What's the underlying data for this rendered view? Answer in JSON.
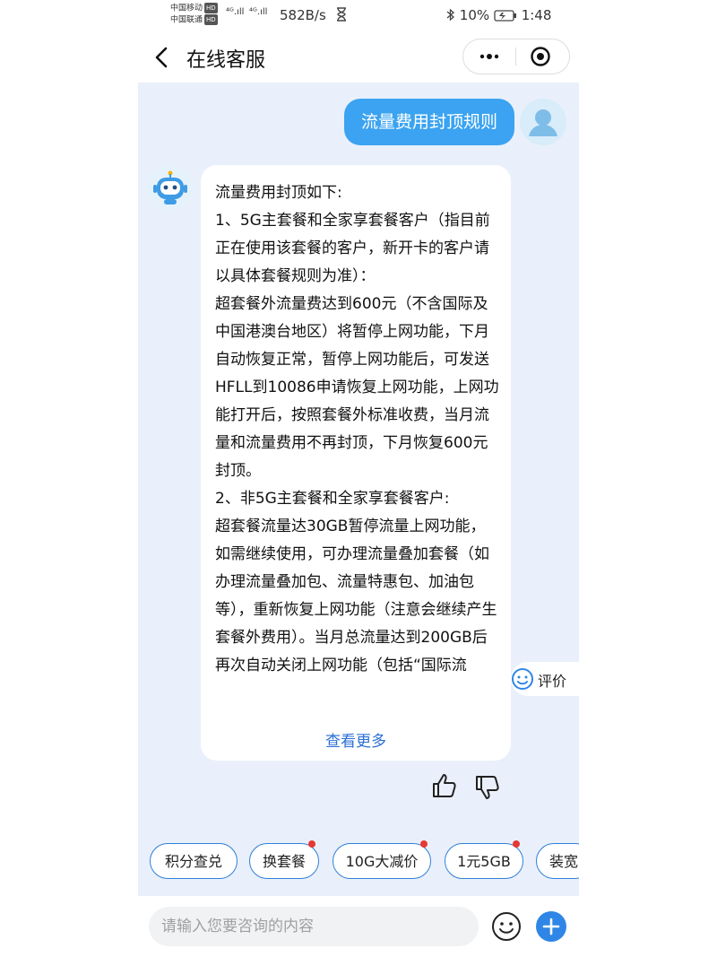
{
  "status_bar": {
    "carrier1": "中国移动",
    "carrier2": "中国联通",
    "hd": "HD",
    "signal1": "⁴ᴳ.ıll",
    "signal2": "⁴ᴳ.ıll",
    "speed": "582B/s",
    "battery": "10%",
    "time": "1:48"
  },
  "header": {
    "title": "在线客服"
  },
  "chat": {
    "user_message": "流量费用封顶规则",
    "bot_message": "流量费用封顶如下:\n1、5G主套餐和全家享套餐客户（指目前正在使用该套餐的客户，新开卡的客户请以具体套餐规则为准）：\n超套餐外流量费达到600元（不含国际及中国港澳台地区）将暂停上网功能，下月自动恢复正常，暂停上网功能后，可发送HFLL到10086申请恢复上网功能，上网功能打开后，按照套餐外标准收费，当月流量和流量费用不再封顶，下月恢复600元封顶。\n2、非5G主套餐和全家享套餐客户:\n超套餐流量达30GB暂停流量上网功能，如需继续使用，可办理流量叠加套餐（如办理流量叠加包、流量特惠包、加油包等），重新恢复上网功能（注意会继续产生套餐外费用）。当月总流量达到200GB后再次自动关闭上网功能（包括“国际流",
    "more_link": "查看更多",
    "rate_label": "评价"
  },
  "quick_chips": [
    {
      "label": "积分查兑",
      "dot": false
    },
    {
      "label": "换套餐",
      "dot": true
    },
    {
      "label": "10G大减价",
      "dot": true
    },
    {
      "label": "1元5GB",
      "dot": true
    },
    {
      "label": "装宽",
      "dot": false
    }
  ],
  "input": {
    "placeholder": "请输入您要咨询的内容"
  },
  "colors": {
    "accent": "#3ba3f1",
    "link": "#2b6fd6",
    "chip_border": "#2f7fd8",
    "badge": "#e53935",
    "chat_bg": "#e9f0fb"
  }
}
